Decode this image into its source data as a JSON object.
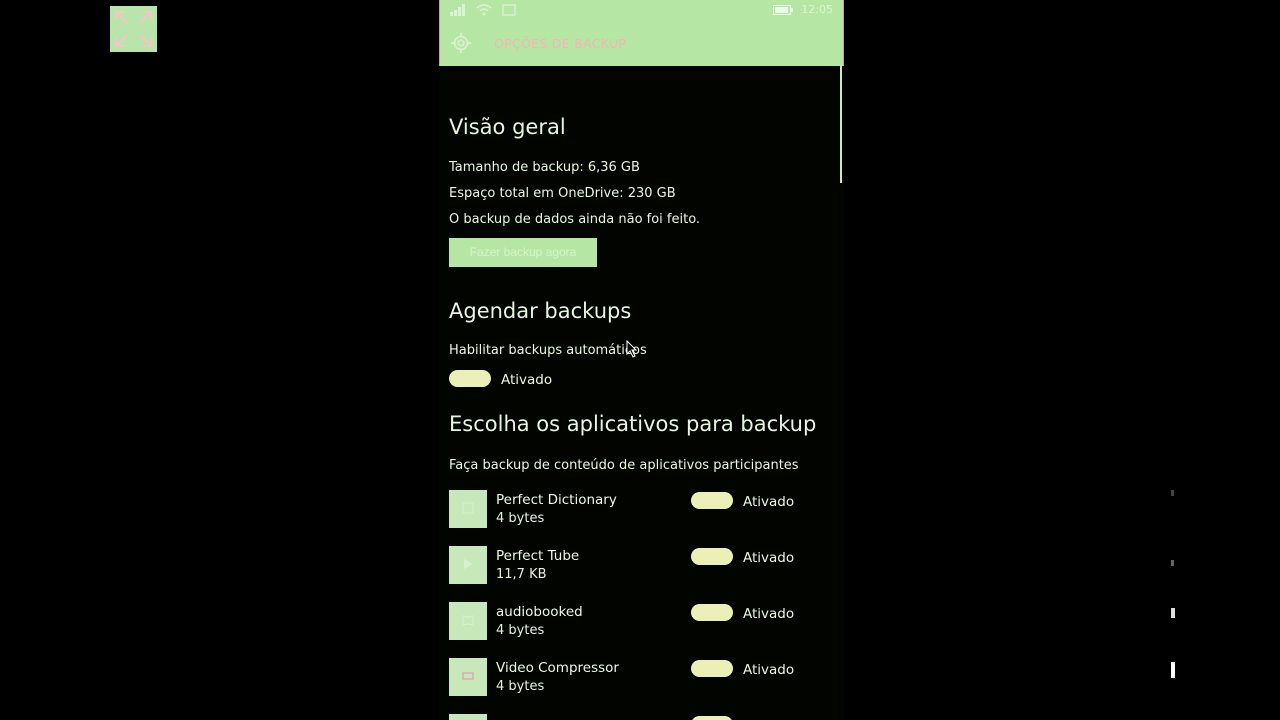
{
  "header": {
    "title": "OPÇÕES DE BACKUP",
    "time": "12:05"
  },
  "overview": {
    "heading": "Visão geral",
    "backup_size": "Tamanho de backup: 6,36 GB",
    "onedrive_total": "Espaço total em OneDrive: 230 GB",
    "status": "O backup de dados ainda não foi feito.",
    "backup_now_label": "Fazer backup agora"
  },
  "schedule": {
    "heading": "Agendar backups",
    "auto_label": "Habilitar backups automáticos",
    "auto_state": "Ativado"
  },
  "apps": {
    "heading": "Escolha os aplicativos para backup",
    "subheading": "Faça backup de conteúdo de aplicativos participantes",
    "items": [
      {
        "name": "Perfect Dictionary",
        "size": "4 bytes",
        "state": "Ativado"
      },
      {
        "name": "Perfect Tube",
        "size": "11,7 KB",
        "state": "Ativado"
      },
      {
        "name": "audiobooked",
        "size": "4 bytes",
        "state": "Ativado"
      },
      {
        "name": "Video Compressor",
        "size": "4 bytes",
        "state": "Ativado"
      }
    ]
  },
  "colors": {
    "accent": "#b6e6a4",
    "toggle_on": "#ebf0b8",
    "background": "#020400",
    "title_text": "#f7b3b6"
  },
  "icons": {
    "fullscreen": "expand-arrows-icon",
    "settings": "gear-icon",
    "signal": "signal-icon",
    "wifi": "wifi-icon",
    "battery": "battery-icon"
  }
}
